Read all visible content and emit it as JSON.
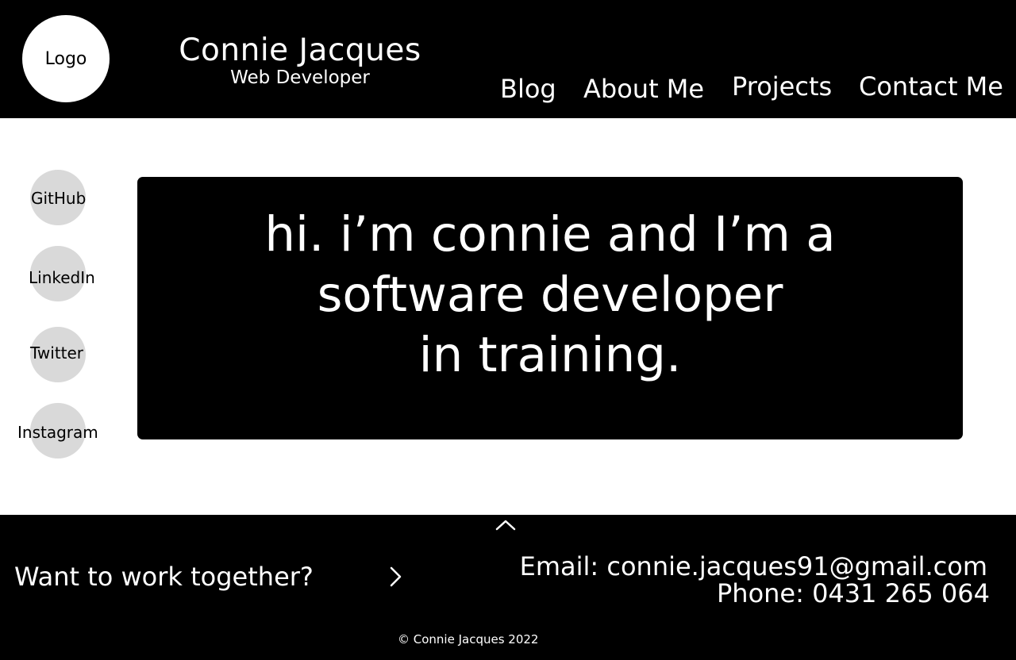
{
  "header": {
    "logo_label": "Logo",
    "name": "Connie Jacques",
    "role": "Web Developer",
    "nav": [
      {
        "label": "Blog"
      },
      {
        "label": "About Me"
      },
      {
        "label": "Projects"
      },
      {
        "label": "Contact Me"
      }
    ]
  },
  "social": [
    {
      "label": "GitHub"
    },
    {
      "label": "LinkedIn"
    },
    {
      "label": "Twitter"
    },
    {
      "label": "Instagram"
    }
  ],
  "hero": {
    "lines": [
      "hi. i’m connie and I’m a",
      "software developer",
      "in training."
    ]
  },
  "footer": {
    "back_to_top_icon": "chevron-up-icon",
    "cta_text": "Want to work together?",
    "cta_icon": "chevron-right-icon",
    "email": "Email: connie.jacques91@gmail.com",
    "phone": "Phone: 0431 265 064",
    "copyright": "© Connie Jacques 2022"
  },
  "colors": {
    "background": "#ffffff",
    "bars": "#000000",
    "social_circle": "#d9d9d9",
    "text_light": "#ffffff",
    "text_dark": "#000000"
  }
}
